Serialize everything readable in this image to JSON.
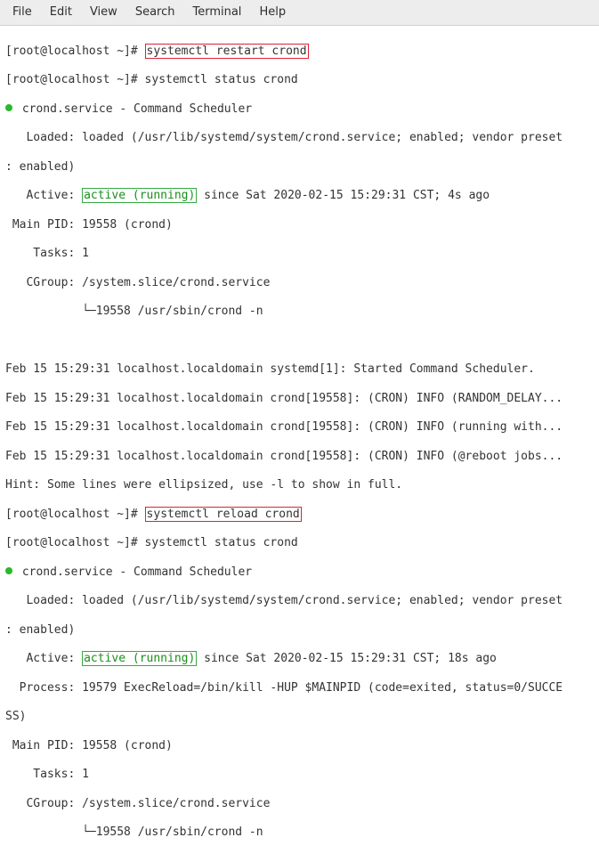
{
  "menu": {
    "items": [
      "File",
      "Edit",
      "View",
      "Search",
      "Terminal",
      "Help"
    ]
  },
  "t": {
    "prompt": "[root@localhost ~]# ",
    "cmd_restart": "systemctl restart crond",
    "cmd_status": "systemctl status crond",
    "cmd_reload": "systemctl reload crond",
    "svc_line": " crond.service - Command Scheduler",
    "loaded": "   Loaded: loaded (/usr/lib/systemd/system/crond.service; enabled; vendor preset",
    "loaded2": ": enabled)",
    "active_pre": "   Active: ",
    "active_state": "active (running)",
    "active_post1": " since Sat 2020-02-15 15:29:31 CST; 4s ago",
    "active_post2": " since Sat 2020-02-15 15:29:31 CST; 18s ago",
    "mainpid": " Main PID: 19558 (crond)",
    "tasks": "    Tasks: 1",
    "cgroup": "   CGroup: /system.slice/crond.service",
    "cgroup_child": "           └─19558 /usr/sbin/crond -n",
    "process": "  Process: 19579 ExecReload=/bin/kill -HUP $MAINPID (code=exited, status=0/SUCCE",
    "process2": "SS)",
    "log1": "Feb 15 15:29:31 localhost.localdomain systemd[1]: Started Command Scheduler.",
    "log2": "Feb 15 15:29:31 localhost.localdomain crond[19558]: (CRON) INFO (RANDOM_DELAY...",
    "log3": "Feb 15 15:29:31 localhost.localdomain crond[19558]: (CRON) INFO (running with...",
    "log4": "Feb 15 15:29:31 localhost.localdomain crond[19558]: (CRON) INFO (@reboot jobs...",
    "hint": "Hint: Some lines were ellipsized, use -l to show in full."
  }
}
